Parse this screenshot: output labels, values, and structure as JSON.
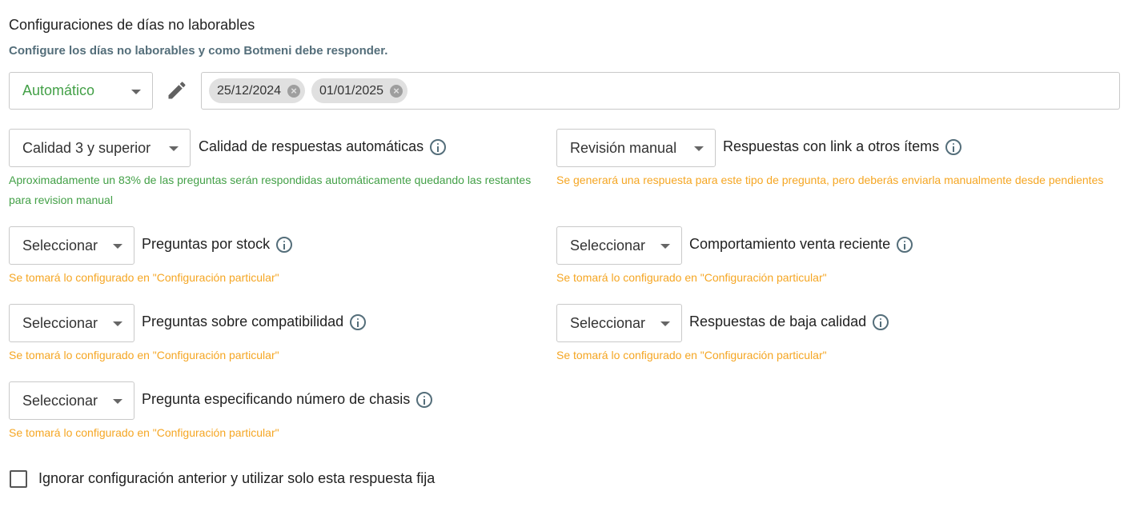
{
  "header": {
    "title": "Configuraciones de días no laborables",
    "subtitle": "Configure los días no laborables y como Botmeni debe responder."
  },
  "mode_select": {
    "value": "Automático"
  },
  "edit_icon": "pencil-icon",
  "dates": [
    {
      "label": "25/12/2024"
    },
    {
      "label": "01/01/2025"
    }
  ],
  "chip_remove_symbol": "×",
  "settings": {
    "quality": {
      "select_value": "Calidad 3 y superior",
      "label": "Calidad de respuestas automáticas",
      "hint": "Aproximadamente un 83% de las preguntas serán respondidas automáticamente quedando las restantes para revision manual"
    },
    "links": {
      "select_value": "Revisión manual",
      "label": "Respuestas con link a otros ítems",
      "hint": "Se generará una respuesta para este tipo de pregunta, pero deberás enviarla manualmente desde pendientes"
    },
    "stock": {
      "select_value": "Seleccionar",
      "label": "Preguntas por stock",
      "hint": "Se tomará lo configurado en \"Configuración particular\""
    },
    "recent_sale": {
      "select_value": "Seleccionar",
      "label": "Comportamiento venta reciente",
      "hint": "Se tomará lo configurado en \"Configuración particular\""
    },
    "compatibility": {
      "select_value": "Seleccionar",
      "label": "Preguntas sobre compatibilidad",
      "hint": "Se tomará lo configurado en \"Configuración particular\""
    },
    "low_quality": {
      "select_value": "Seleccionar",
      "label": "Respuestas de baja calidad",
      "hint": "Se tomará lo configurado en \"Configuración particular\""
    },
    "chassis": {
      "select_value": "Seleccionar",
      "label": "Pregunta especificando número de chasis",
      "hint": "Se tomará lo configurado en \"Configuración particular\""
    }
  },
  "ignore_checkbox": {
    "label": "Ignorar configuración anterior y utilizar solo esta respuesta fija",
    "checked": false
  },
  "colors": {
    "green": "#43a047",
    "orange": "#f5a623",
    "subtitle": "#546e7a"
  }
}
